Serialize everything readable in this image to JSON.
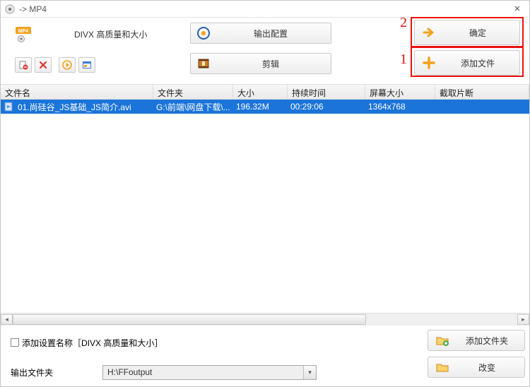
{
  "title": "-> MP4",
  "preset_label": "DIVX 高质量和大小",
  "buttons": {
    "output_config": "输出配置",
    "trim": "剪辑",
    "ok": "确定",
    "add_file": "添加文件",
    "add_folder": "添加文件夹",
    "change": "改变"
  },
  "annotations": {
    "num1": "1",
    "num2": "2"
  },
  "columns": {
    "name": "文件名",
    "folder": "文件夹",
    "size": "大小",
    "duration": "持续时间",
    "dimensions": "屏幕大小",
    "clip": "截取片断"
  },
  "rows": [
    {
      "name": "01.尚硅谷_JS基础_JS简介.avi",
      "folder": "G:\\前端\\网盘下载\\...",
      "size": "196.32M",
      "duration": "00:29:06",
      "dimensions": "1364x768",
      "clip": ""
    }
  ],
  "option_label": "添加设置名称［DIVX 高质量和大小］",
  "output": {
    "label": "输出文件夹",
    "value": "H:\\FFoutput"
  }
}
